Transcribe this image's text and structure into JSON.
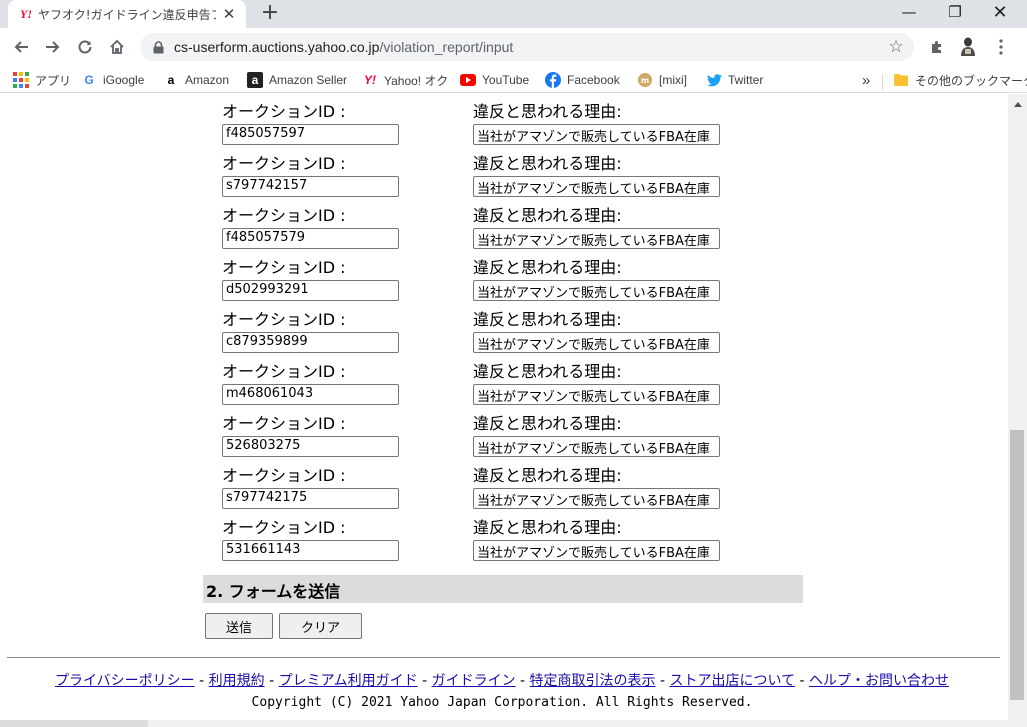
{
  "browser": {
    "tab_favicon": "Y!",
    "tab_title": "ヤフオク!ガイドライン違反申告フォーム",
    "tab_close": "✕",
    "new_tab": "+",
    "url_host": "cs-userform.auctions.yahoo.co.jp",
    "url_path": "/violation_report/input",
    "window_min": "—",
    "window_max": "❐",
    "window_close": "✕"
  },
  "bookmarks": [
    {
      "label": "アプリ",
      "icon": "apps-grid-icon"
    },
    {
      "label": "iGoogle",
      "icon": "google-icon"
    },
    {
      "label": "Amazon",
      "icon": "amazon-icon"
    },
    {
      "label": "Amazon Seller",
      "icon": "amazon-seller-icon"
    },
    {
      "label": "Yahoo! オク",
      "icon": "yahoo-icon"
    },
    {
      "label": "YouTube",
      "icon": "youtube-icon"
    },
    {
      "label": "Facebook",
      "icon": "facebook-icon"
    },
    {
      "label": "[mixi]",
      "icon": "mixi-icon"
    },
    {
      "label": "Twitter",
      "icon": "twitter-icon"
    }
  ],
  "bookmarks_overflow": "»",
  "other_bookmarks": "その他のブックマーク",
  "form": {
    "id_label": "オークションID :",
    "reason_label": "違反と思われる理由:",
    "rows": [
      {
        "auction_id": "f485057597",
        "reason": "当社がアマゾンで販売しているFBA在庫"
      },
      {
        "auction_id": "s797742157",
        "reason": "当社がアマゾンで販売しているFBA在庫"
      },
      {
        "auction_id": "f485057579",
        "reason": "当社がアマゾンで販売しているFBA在庫"
      },
      {
        "auction_id": "d502993291",
        "reason": "当社がアマゾンで販売しているFBA在庫"
      },
      {
        "auction_id": "c879359899",
        "reason": "当社がアマゾンで販売しているFBA在庫"
      },
      {
        "auction_id": "m468061043",
        "reason": "当社がアマゾンで販売しているFBA在庫"
      },
      {
        "auction_id": "526803275",
        "reason": "当社がアマゾンで販売しているFBA在庫"
      },
      {
        "auction_id": "s797742175",
        "reason": "当社がアマゾンで販売しているFBA在庫"
      },
      {
        "auction_id": "531661143",
        "reason": "当社がアマゾンで販売しているFBA在庫"
      }
    ],
    "section_title": "2. フォームを送信",
    "submit_label": "送信",
    "clear_label": "クリア"
  },
  "footer": {
    "links": [
      "プライバシーポリシー",
      "利用規約",
      "プレミアム利用ガイド",
      "ガイドライン",
      "特定商取引法の表示",
      "ストア出店について",
      "ヘルプ・お問い合わせ"
    ],
    "separator": " - ",
    "copyright": "Copyright (C) 2021 Yahoo Japan Corporation. All Rights Reserved."
  },
  "colors": {
    "link": "#1a0dab",
    "section_bg": "#dcdcdc",
    "tabstrip_bg": "#dee1e6",
    "yahoo_red": "#ff0033"
  }
}
